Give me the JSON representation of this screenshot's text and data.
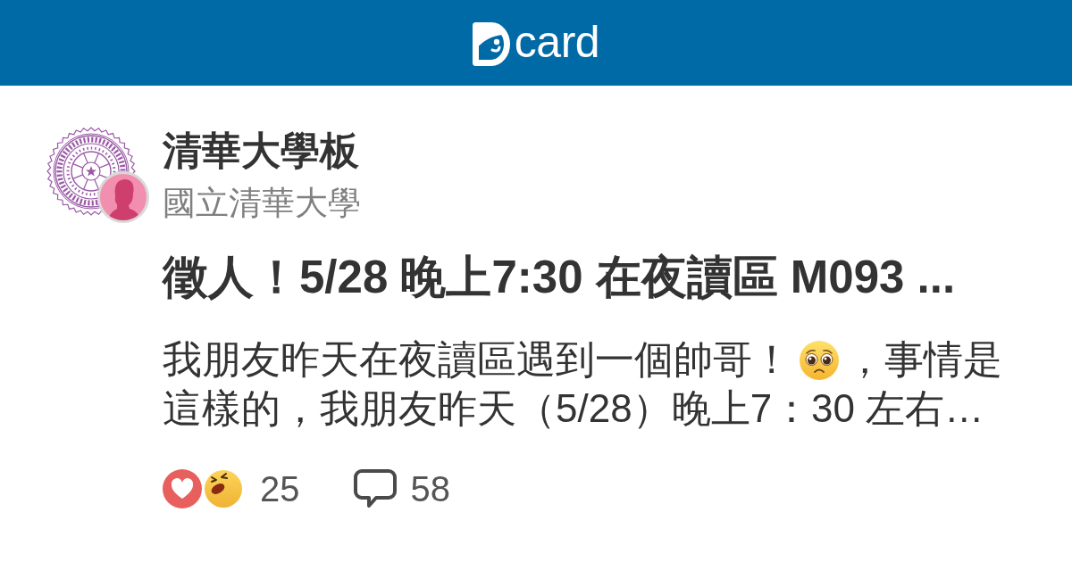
{
  "header": {
    "logo_text": "card"
  },
  "board": {
    "name": "清華大學板",
    "school": "國立清華大學"
  },
  "post": {
    "title": "徵人！5/28 晚上7:30 在夜讀區 M093 ...",
    "excerpt": {
      "lines": [
        {
          "segments": [
            {
              "kind": "text",
              "text": "我朋友昨天在夜讀區遇到一個帥哥！"
            },
            {
              "kind": "emoji"
            },
            {
              "kind": "text",
              "text": "，事情是"
            }
          ]
        },
        {
          "segments": [
            {
              "kind": "text",
              "text": "這樣的，我朋友昨天（5/28）晚上7：30 左右…"
            }
          ]
        }
      ]
    },
    "reaction_count": "25",
    "comment_count": "58"
  }
}
